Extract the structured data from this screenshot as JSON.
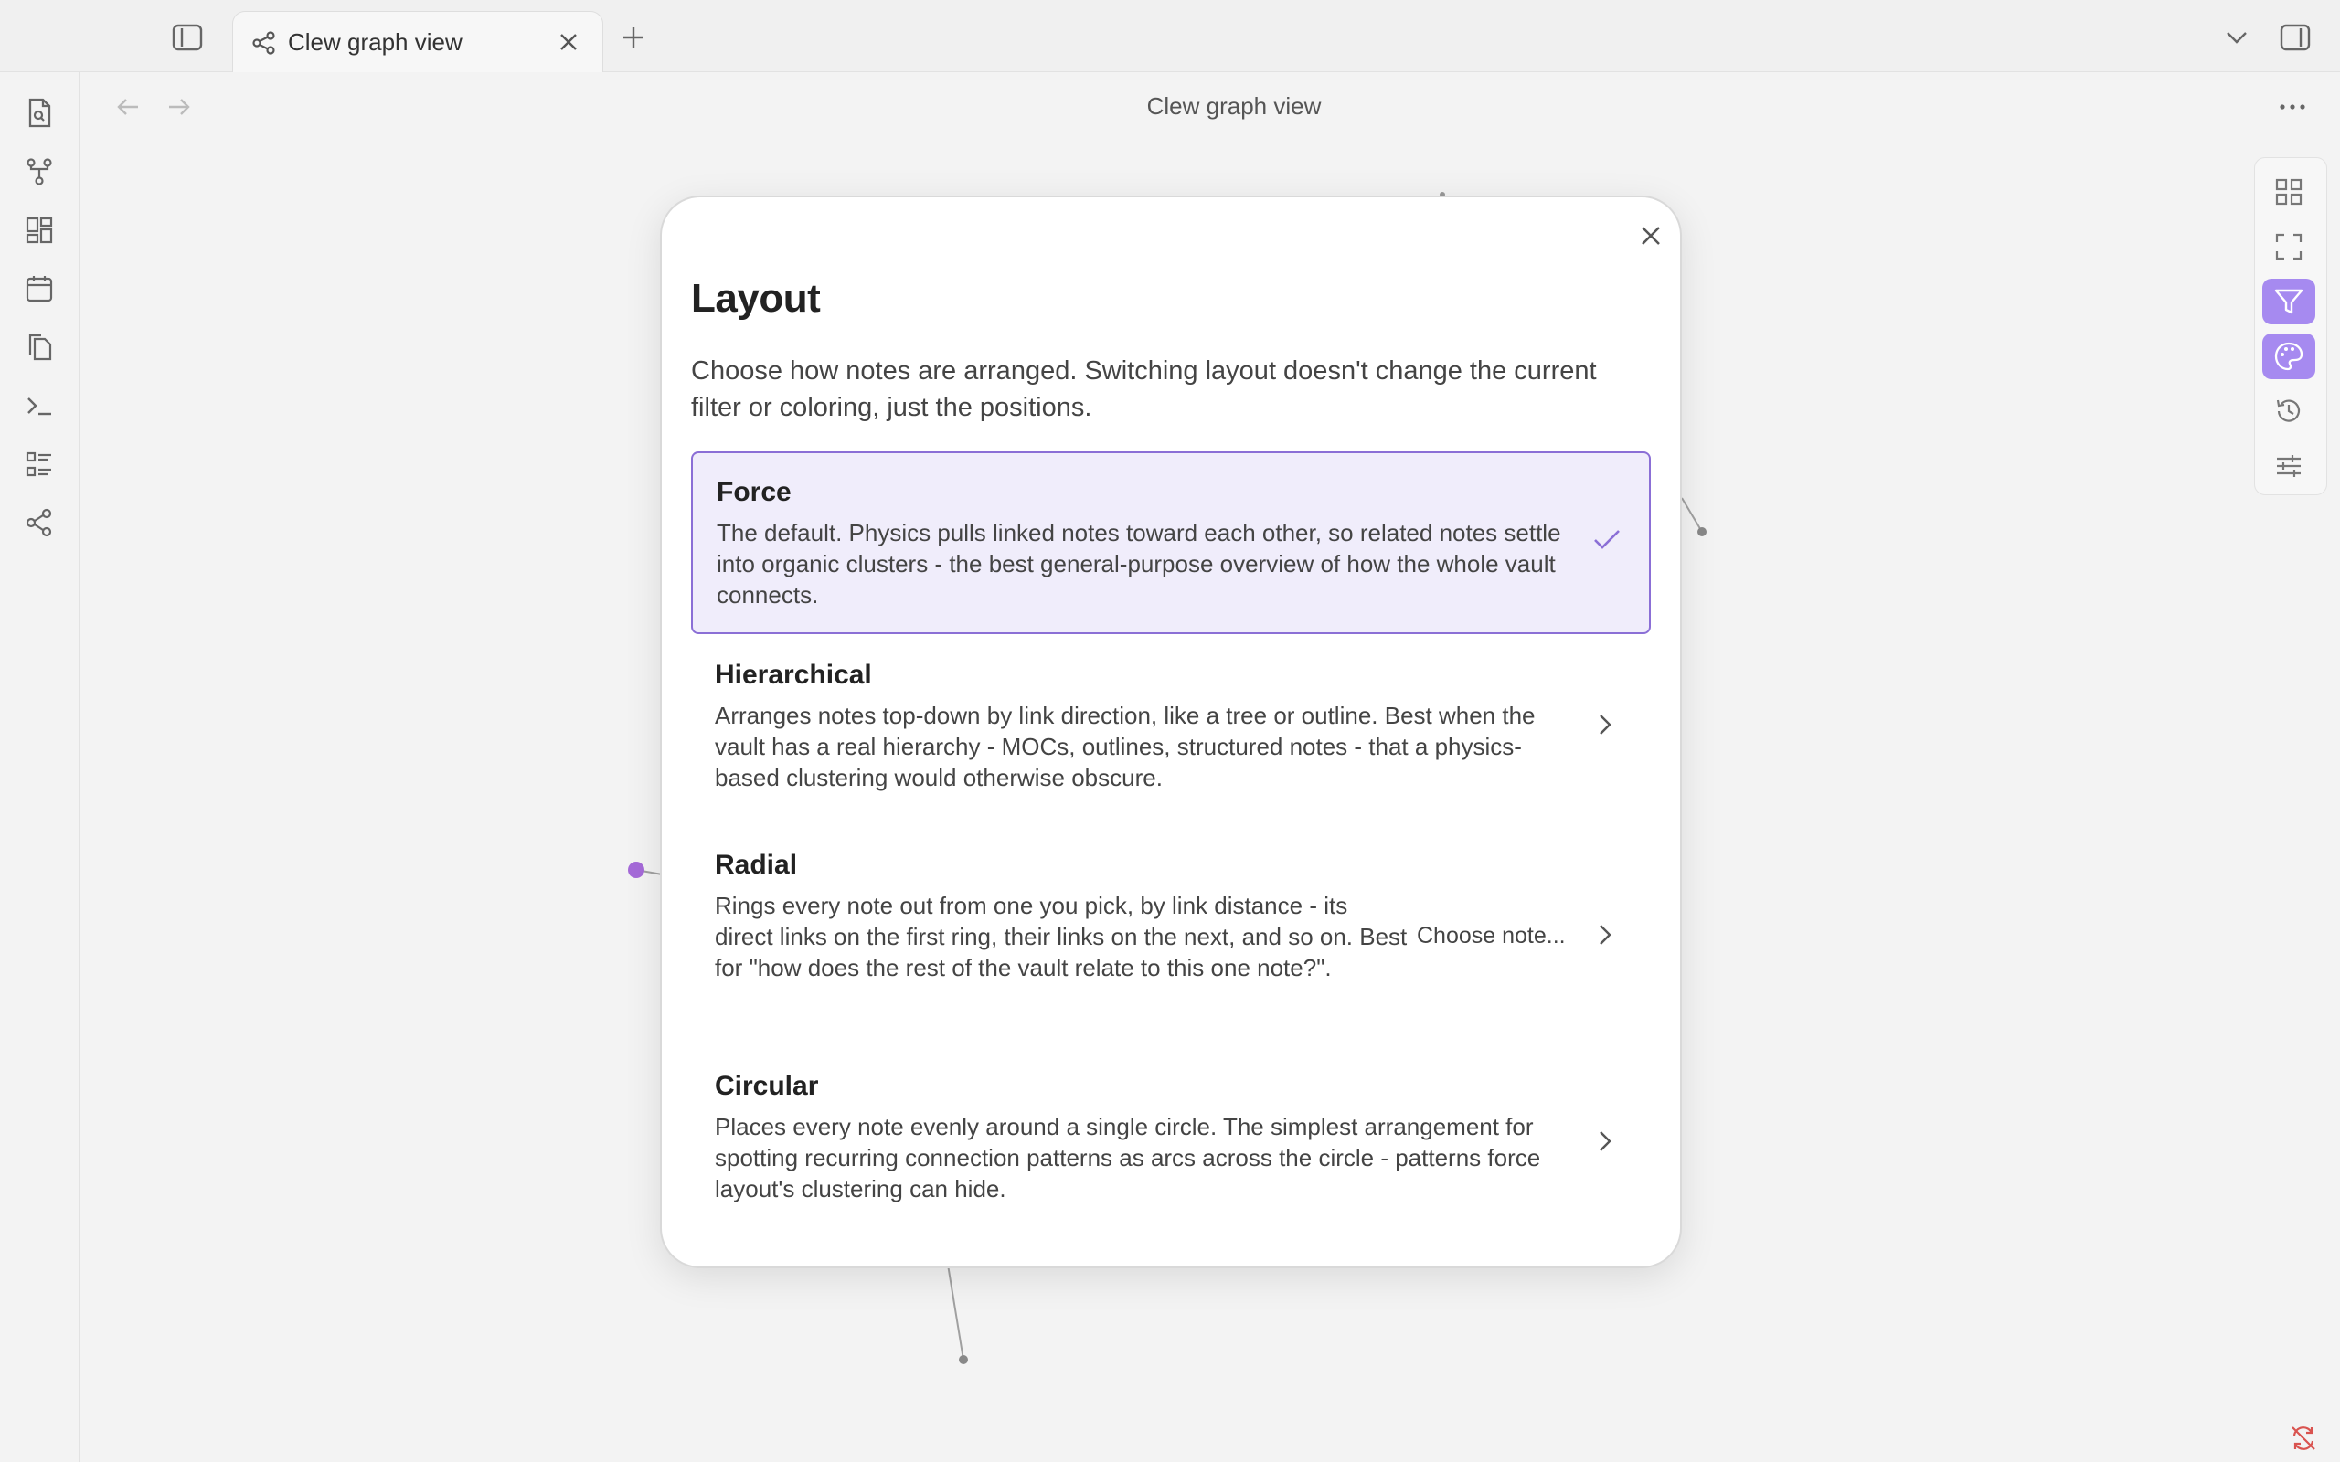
{
  "tabbar": {
    "tab_title": "Clew graph view"
  },
  "header": {
    "title": "Clew graph view"
  },
  "ribbon": {
    "items": [
      {
        "name": "search-file-icon"
      },
      {
        "name": "git-fork-icon"
      },
      {
        "name": "dashboard-icon"
      },
      {
        "name": "calendar-icon"
      },
      {
        "name": "files-icon"
      },
      {
        "name": "terminal-icon"
      },
      {
        "name": "list-icon"
      },
      {
        "name": "share-graph-icon"
      }
    ]
  },
  "right_toolbar": {
    "items": [
      {
        "name": "grid-icon",
        "active": false
      },
      {
        "name": "fullscreen-icon",
        "active": false
      },
      {
        "name": "filter-icon",
        "active": true
      },
      {
        "name": "palette-icon",
        "active": true
      },
      {
        "name": "history-icon",
        "active": false
      },
      {
        "name": "sliders-icon",
        "active": false
      }
    ]
  },
  "modal": {
    "title": "Layout",
    "description": "Choose how notes are arranged. Switching layout doesn't change the current filter or coloring, just the positions.",
    "options": [
      {
        "title": "Force",
        "text": "The default. Physics pulls linked notes toward each other, so related notes settle into organic clusters - the best general-purpose overview of how the whole vault connects.",
        "selected": true
      },
      {
        "title": "Hierarchical",
        "text": "Arranges notes top-down by link direction, like a tree or outline. Best when the vault has a real hierarchy - MOCs, outlines, structured notes - that a physics-based clustering would otherwise obscure.",
        "selected": false
      },
      {
        "title": "Radial",
        "text": "Rings every note out from one you pick, by link distance - its direct links on the first ring, their links on the next, and so on. Best for \"how does the rest of the vault relate to this one note?\".",
        "aside": "Choose note...",
        "selected": false
      },
      {
        "title": "Circular",
        "text": "Places every note evenly around a single circle. The simplest arrangement for spotting recurring connection patterns as arcs across the circle - patterns force layout's clustering can hide.",
        "selected": false
      }
    ]
  },
  "colors": {
    "accent": "#8b6fd6",
    "accent_button": "#a68af0",
    "selected_bg": "#f0edfb",
    "node_purple": "#a56ad8",
    "node_gray": "#888888",
    "status_red": "#d9534f"
  }
}
